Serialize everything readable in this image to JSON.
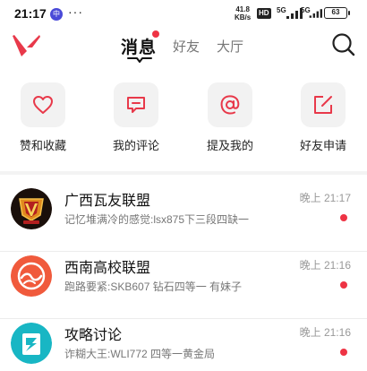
{
  "status_bar": {
    "time": "21:17",
    "app_icon_text": "中",
    "dots": "···",
    "speed_value": "41.8",
    "speed_unit": "KB/s",
    "hd": "HD",
    "net1": "5G",
    "net2": "5G",
    "battery": "63"
  },
  "header": {
    "tabs": [
      {
        "label": "消息",
        "active": true
      },
      {
        "label": "好友",
        "active": false
      },
      {
        "label": "大厅",
        "active": false
      }
    ]
  },
  "quick_actions": [
    {
      "label": "赞和收藏",
      "icon": "heart-icon"
    },
    {
      "label": "我的评论",
      "icon": "comment-icon"
    },
    {
      "label": "提及我的",
      "icon": "at-icon"
    },
    {
      "label": "好友申请",
      "icon": "edit-icon"
    }
  ],
  "conversations": [
    {
      "title": "广西瓦友联盟",
      "subtitle": "记忆堆满冷的感觉:lsx875下三段四缺一",
      "time": "晚上 21:17",
      "unread": true
    },
    {
      "title": "西南高校联盟",
      "subtitle": "跑路要紧:SKB607 钻石四等一 有妹子",
      "time": "晚上 21:16",
      "unread": true
    },
    {
      "title": "攻略讨论",
      "subtitle": "诈糊大王:WLI772 四等一黄金局",
      "time": "晚上 21:16",
      "unread": true
    }
  ],
  "colors": {
    "accent": "#ee3344",
    "brand_red": "#e8394a"
  }
}
